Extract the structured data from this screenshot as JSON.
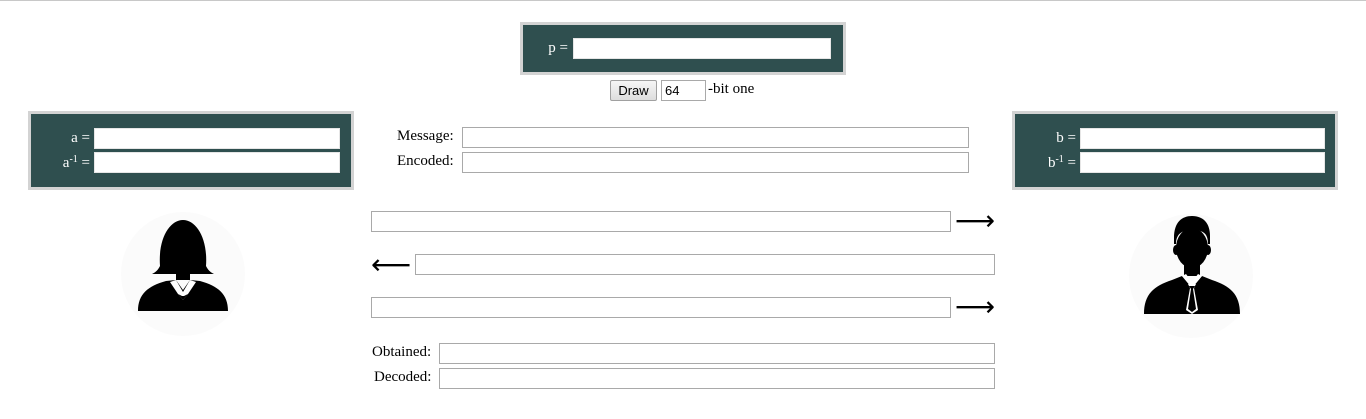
{
  "p_panel": {
    "label": "p =",
    "value": ""
  },
  "draw": {
    "button_label": "Draw",
    "bits_value": "64",
    "suffix": "-bit one"
  },
  "alice": {
    "a_label": "a =",
    "a_value": "",
    "ainv_base": "a",
    "ainv_sup": "-1",
    "ainv_eq": "=",
    "ainv_value": "",
    "avatar_icon": "woman-silhouette-icon"
  },
  "bob": {
    "b_label": "b =",
    "b_value": "",
    "binv_base": "b",
    "binv_sup": "-1",
    "binv_eq": "=",
    "binv_value": "",
    "avatar_icon": "man-silhouette-icon"
  },
  "message": {
    "label": "Message:",
    "value": ""
  },
  "encoded": {
    "label": "Encoded:",
    "value": ""
  },
  "transfer": {
    "step1_value": "",
    "step1_arrow": "⟶",
    "step2_value": "",
    "step2_arrow": "⟵",
    "step3_value": "",
    "step3_arrow": "⟶"
  },
  "obtained": {
    "label": "Obtained:",
    "value": ""
  },
  "decoded": {
    "label": "Decoded:",
    "value": ""
  }
}
